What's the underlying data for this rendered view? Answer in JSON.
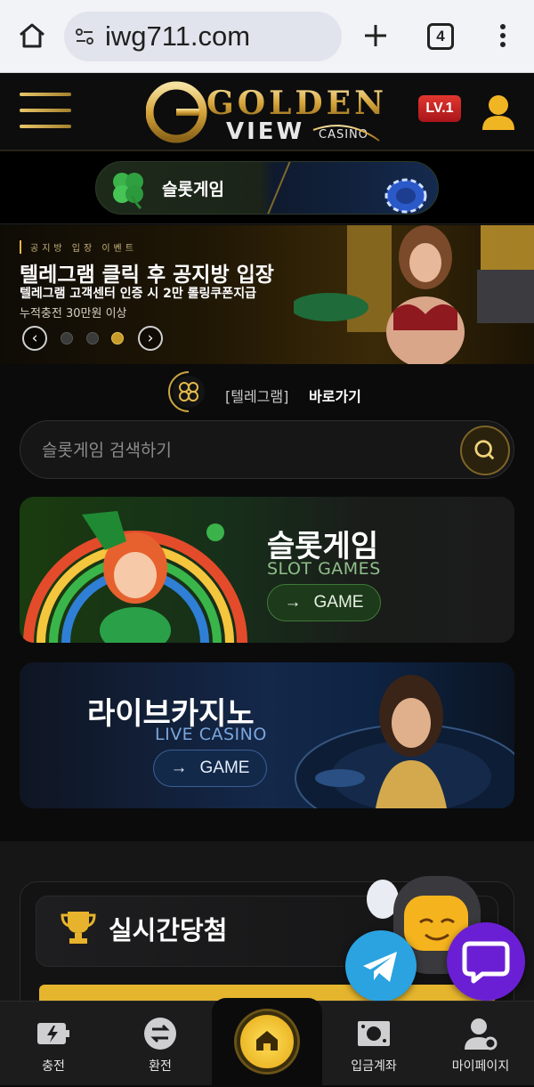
{
  "browser": {
    "url": "iwg711.com",
    "tab_count": "4"
  },
  "header": {
    "logo_text_1": "GOLDEN",
    "logo_text_2": "VIEW",
    "logo_text_3": "CASINO",
    "level_badge": "LV.1"
  },
  "category_tab": {
    "label": "슬롯게임"
  },
  "banner": {
    "eyebrow": "공지방 입장 이벤트",
    "title": "텔레그램 클릭 후 공지방 입장",
    "subtitle": "텔레그램 고객센터 인증 시 2만 롤링쿠폰지급",
    "note": "누적충전 30만원 이상",
    "slide_count": 3,
    "active_slide": 3
  },
  "telegram_link": {
    "bracket_label": "[텔레그램]",
    "action_label": "바로가기"
  },
  "search": {
    "placeholder": "슬롯게임 검색하기"
  },
  "games": {
    "slot": {
      "title_ko": "슬롯게임",
      "title_en": "SLOT GAMES",
      "button": "GAME"
    },
    "live": {
      "title_ko": "라이브카지노",
      "title_en": "LIVE CASINO",
      "button": "GAME"
    }
  },
  "winners": {
    "title": "실시간당첨"
  },
  "bottom_nav": {
    "items": [
      {
        "label": "충전"
      },
      {
        "label": "환전"
      },
      {
        "label": "입금계좌"
      },
      {
        "label": "마이페이지"
      }
    ]
  },
  "colors": {
    "gold": "#e3b94a",
    "telegram": "#2aa3e0",
    "chat": "#6b1fd4",
    "level_red": "#d22a25"
  }
}
